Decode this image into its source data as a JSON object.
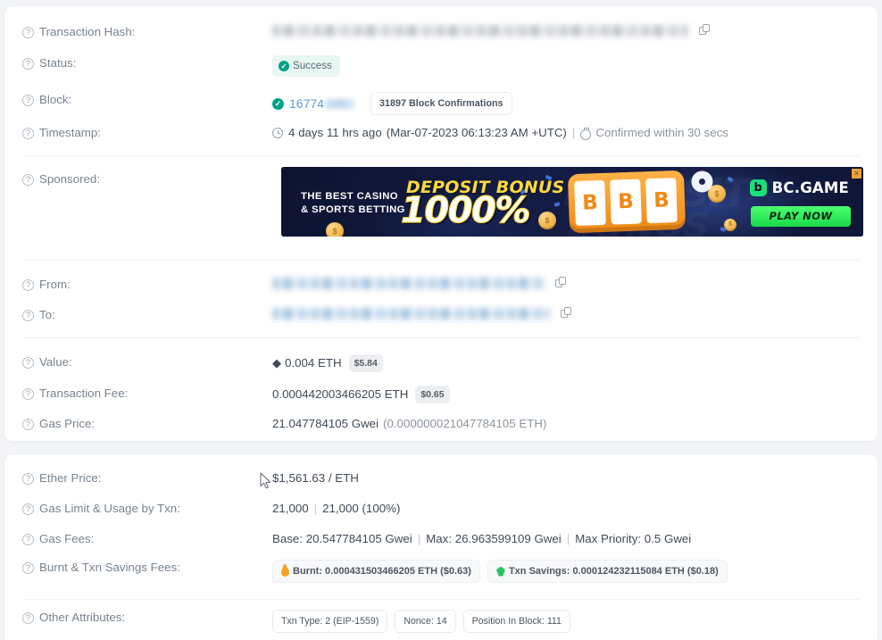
{
  "colors": {
    "success_green": "#00a186",
    "link_blue": "#5b9ad5",
    "label_gray": "#77838f",
    "value_gray": "#3f4a57",
    "burnt_orange": "#f5a524",
    "savings_green": "#21c55d",
    "card_bg": "#ffffff",
    "page_bg": "#f3f4f8"
  },
  "icons": {
    "help": "?",
    "check": "✓",
    "copy": "copy-icon",
    "eth": "◆"
  },
  "rows": {
    "transaction_hash": {
      "label": "Transaction Hash:",
      "value_redacted": true
    },
    "status": {
      "label": "Status:",
      "badge": "Success"
    },
    "block": {
      "label": "Block:",
      "number_visible": "16774",
      "confirmations": "31897 Block Confirmations"
    },
    "timestamp": {
      "label": "Timestamp:",
      "relative": "4 days 11 hrs ago",
      "absolute": "(Mar-07-2023 06:13:23 AM +UTC)",
      "separator": "|",
      "confirmed": "Confirmed within 30 secs"
    },
    "sponsored": {
      "label": "Sponsored:"
    },
    "from": {
      "label": "From:",
      "value_redacted": true
    },
    "to": {
      "label": "To:",
      "value_redacted": true
    },
    "value": {
      "label": "Value:",
      "amount": "0.004 ETH",
      "fiat": "$5.84"
    },
    "transaction_fee": {
      "label": "Transaction Fee:",
      "amount": "0.000442003466205 ETH",
      "fiat": "$0.65"
    },
    "gas_price": {
      "label": "Gas Price:",
      "gwei": "21.047784105 Gwei",
      "eth": "(0.000000021047784105 ETH)"
    },
    "ether_price": {
      "label": "Ether Price:",
      "value": "$1,561.63 / ETH"
    },
    "gas_limit": {
      "label": "Gas Limit & Usage by Txn:",
      "limit": "21,000",
      "separator": "|",
      "usage": "21,000 (100%)"
    },
    "gas_fees": {
      "label": "Gas Fees:",
      "base": "Base: 20.547784105 Gwei",
      "sep1": "|",
      "max": "Max: 26.963599109 Gwei",
      "sep2": "|",
      "max_priority": "Max Priority: 0.5 Gwei"
    },
    "burnt_savings": {
      "label": "Burnt & Txn Savings Fees:",
      "burnt": "Burnt: 0.000431503466205 ETH ($0.63)",
      "savings": "Txn Savings: 0.000124232115084 ETH ($0.18)"
    },
    "other_attributes": {
      "label": "Other Attributes:",
      "items": [
        "Txn Type: 2 (EIP-1559)",
        "Nonce: 14",
        "Position In Block: 111"
      ]
    }
  },
  "ad": {
    "tagline_line1": "THE BEST CASINO",
    "tagline_line2": "& SPORTS BETTING",
    "bonus": "DEPOSIT BONUS",
    "percent": "1000%",
    "ghost": "DEPOSIT",
    "ghost2": "BONUS",
    "brand_mark": "b",
    "brand_name": "BC.GAME",
    "cta": "PLAY NOW",
    "reel1": "B",
    "reel2": "B",
    "reel3": "B",
    "close": "×"
  }
}
